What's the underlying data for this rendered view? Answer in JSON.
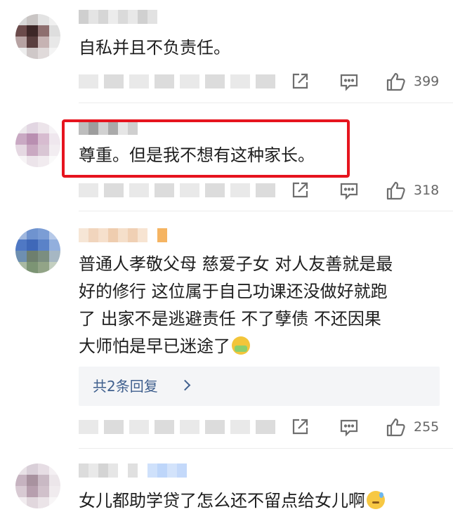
{
  "comments": [
    {
      "text": "自私并且不负责任。",
      "likes": "399"
    },
    {
      "text": "尊重。但是我不想有这种家长。",
      "likes": "318",
      "highlighted": true
    },
    {
      "text_lines": [
        "普通人孝敬父母  慈爱子女  对人友善就是最",
        "好的修行  这位属于自己功课还没做好就跑",
        "了  出家不是逃避责任  不了孽债  不还因果",
        "大师怕是早已迷途了"
      ],
      "emoji": "mask-face-emoji",
      "replies_label": "共2条回复",
      "likes": "255"
    },
    {
      "text": "女儿都助学贷了怎么还不留点给女儿啊",
      "emoji": "sweat-smile-emoji"
    }
  ],
  "icons": {
    "share": "share-icon",
    "reply": "reply-icon",
    "like": "thumbs-up-icon",
    "replies_more": "chevron-right-icon"
  },
  "colors": {
    "highlight_border": "#e6141e",
    "reply_link": "#40608e",
    "like_count": "#666666"
  }
}
